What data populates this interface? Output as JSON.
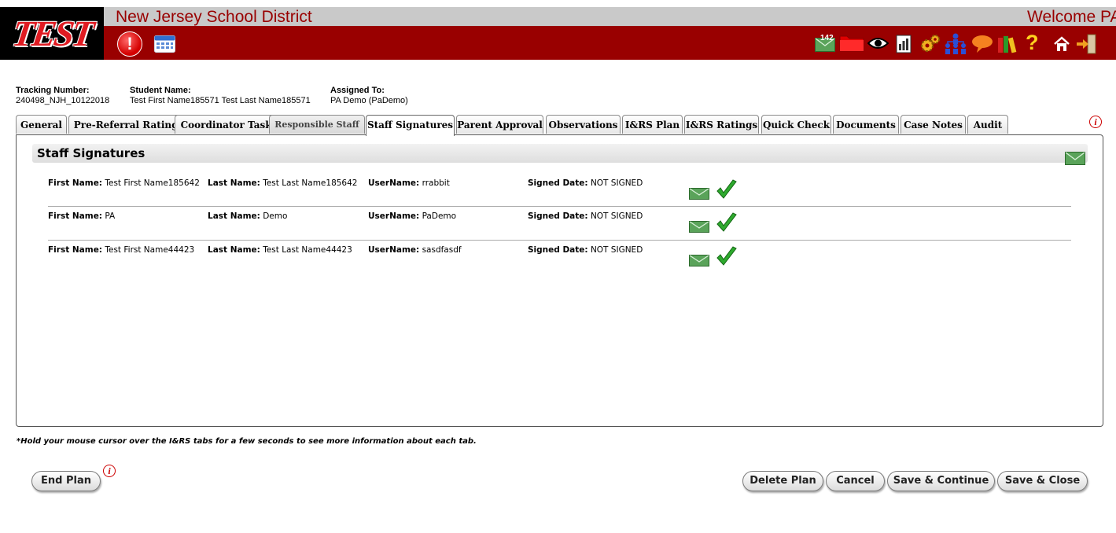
{
  "header": {
    "logo_text": "TEST",
    "district": "New Jersey School District",
    "welcome": "Welcome PA",
    "mail_count": "142",
    "colors": {
      "band": "#990000",
      "strip": "#c9c9c9",
      "logo_bg": "#000000",
      "logo_text": "#e01b22"
    }
  },
  "info": {
    "tracking": {
      "label": "Tracking Number:",
      "value": "240498_NJH_10122018"
    },
    "student": {
      "label": "Student Name:",
      "value": "Test First Name185571 Test Last Name185571"
    },
    "assigned": {
      "label": "Assigned To:",
      "value": "PA Demo (PaDemo)"
    }
  },
  "tabs": [
    {
      "label": "General"
    },
    {
      "label": "Pre-Referral Ratings"
    },
    {
      "label": "Coordinator Tasks"
    },
    {
      "label": "Responsible Staff"
    },
    {
      "label": "Staff Signatures",
      "active": true
    },
    {
      "label": "Parent Approval"
    },
    {
      "label": "Observations"
    },
    {
      "label": "I&RS Plan"
    },
    {
      "label": "I&RS Ratings"
    },
    {
      "label": "Quick Check"
    },
    {
      "label": "Documents"
    },
    {
      "label": "Case Notes"
    },
    {
      "label": "Audit"
    }
  ],
  "section": {
    "title": "Staff Signatures"
  },
  "field_labels": {
    "first": "First Name:",
    "last": "Last Name:",
    "user": "UserName:",
    "signed": "Signed Date:"
  },
  "staff": [
    {
      "first": "Test First Name185642",
      "last": "Test Last Name185642",
      "user": "rrabbit",
      "signed": "NOT SIGNED"
    },
    {
      "first": "PA",
      "last": "Demo",
      "user": "PaDemo",
      "signed": "NOT SIGNED"
    },
    {
      "first": "Test First Name44423",
      "last": "Test Last Name44423",
      "user": "sasdfasdf",
      "signed": "NOT SIGNED"
    }
  ],
  "note": "*Hold your mouse cursor over the I&RS tabs for a few seconds to see more information about each tab.",
  "buttons": {
    "end_plan": "End Plan",
    "delete_plan": "Delete Plan",
    "cancel": "Cancel",
    "save_continue": "Save & Continue",
    "save_close": "Save & Close"
  }
}
